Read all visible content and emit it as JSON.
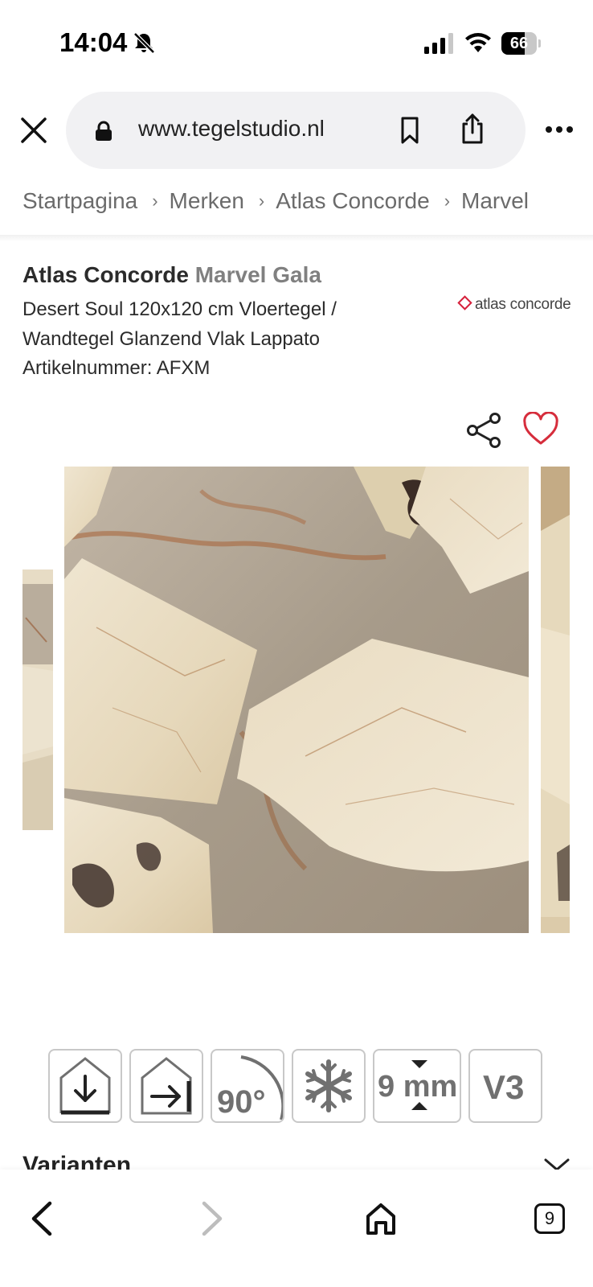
{
  "status_bar": {
    "time": "14:04",
    "battery": "66",
    "battery_level": 0.66,
    "icons": [
      "bell-slash-icon",
      "signal-icon",
      "wifi-icon",
      "battery-icon"
    ]
  },
  "browser": {
    "url": "www.tegelstudio.nl",
    "icons": [
      "close-icon",
      "lock-icon",
      "bookmark-icon",
      "share-icon",
      "more-icon"
    ]
  },
  "breadcrumb": {
    "items": [
      "Startpagina",
      "Merken",
      "Atlas Concorde",
      "Marvel"
    ],
    "separator": "›"
  },
  "product": {
    "brand": "Atlas Concorde",
    "series": "Marvel Gala",
    "description_line1": "Desert Soul 120x120 cm Vloertegel /",
    "description_line2": "Wandtegel Glanzend Vlak Lappato",
    "sku": "Artikelnummer: AFXM",
    "logo_text": "atlas concorde",
    "logo_color": "#d61f3a",
    "favorite_color": "#d62d3c"
  },
  "features": {
    "rotation": "90°",
    "thickness_value": "9",
    "thickness_unit": "mm",
    "rating": "V3",
    "icons": [
      "indoor-floor-icon",
      "indoor-wall-icon",
      "rotation-icon",
      "frost-resistant-icon",
      "thickness-icon",
      "shade-variation-icon"
    ]
  },
  "varianten": {
    "label": "Varianten"
  },
  "bottom_nav": {
    "tab_count": "9",
    "icons": [
      "back-icon",
      "forward-icon",
      "home-icon",
      "tabs-icon"
    ]
  }
}
